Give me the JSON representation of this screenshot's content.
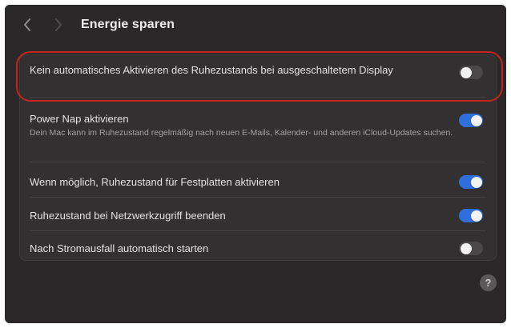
{
  "window": {
    "title": "Energie sparen"
  },
  "nav": {
    "back_icon": "chevron-left-icon",
    "forward_icon": "chevron-right-icon"
  },
  "settings": [
    {
      "label": "Kein automatisches Aktivieren des Ruhezustands bei ausgeschaltetem Display",
      "enabled": false
    },
    {
      "label": "Power Nap aktivieren",
      "description": "Dein Mac kann im Ruhezustand regelmäßig nach neuen E-Mails, Kalender- und anderen iCloud-Updates suchen.",
      "enabled": true
    },
    {
      "label": "Wenn möglich, Ruhezustand für Festplatten aktivieren",
      "enabled": true
    },
    {
      "label": "Ruhezustand bei Netzwerkzugriff beenden",
      "enabled": true
    },
    {
      "label": "Nach Stromausfall automatisch starten",
      "enabled": false
    }
  ],
  "help": {
    "label": "?"
  },
  "colors": {
    "toggle_on": "#2f6fdb",
    "highlight": "#c4261e",
    "window_bg": "#2a2828"
  }
}
